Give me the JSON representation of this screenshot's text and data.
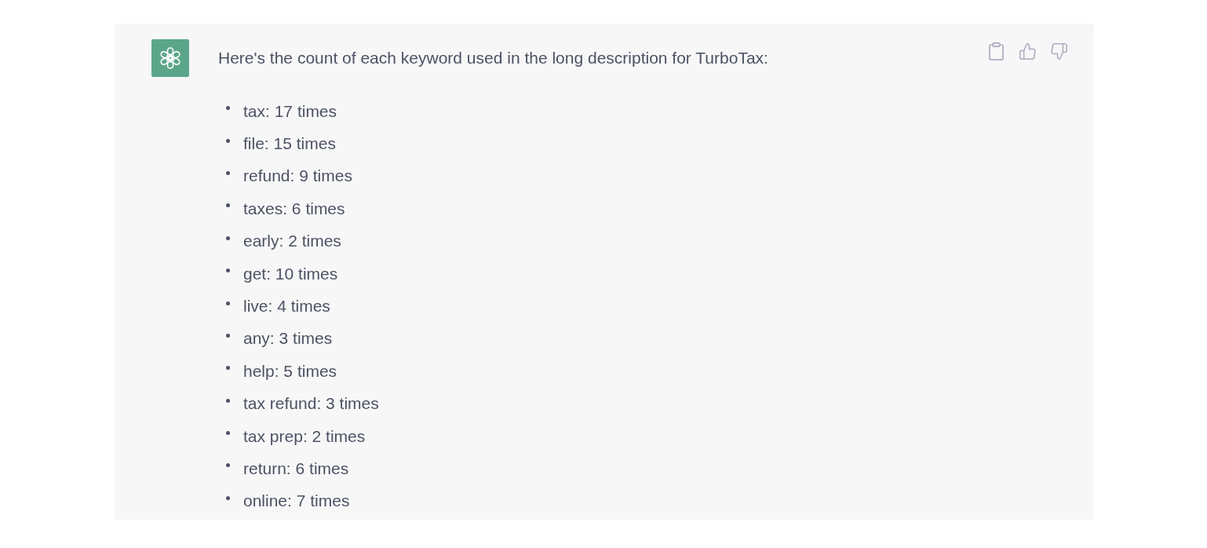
{
  "message": {
    "text": "Here's the count of each keyword used in the long description for TurboTax:"
  },
  "keywords": [
    "tax: 17 times",
    "file: 15 times",
    "refund: 9 times",
    "taxes: 6 times",
    "early: 2 times",
    "get: 10 times",
    "live: 4 times",
    "any: 3 times",
    "help: 5 times",
    "tax refund: 3 times",
    "tax prep: 2 times",
    "return: 6 times",
    "online: 7 times"
  ]
}
